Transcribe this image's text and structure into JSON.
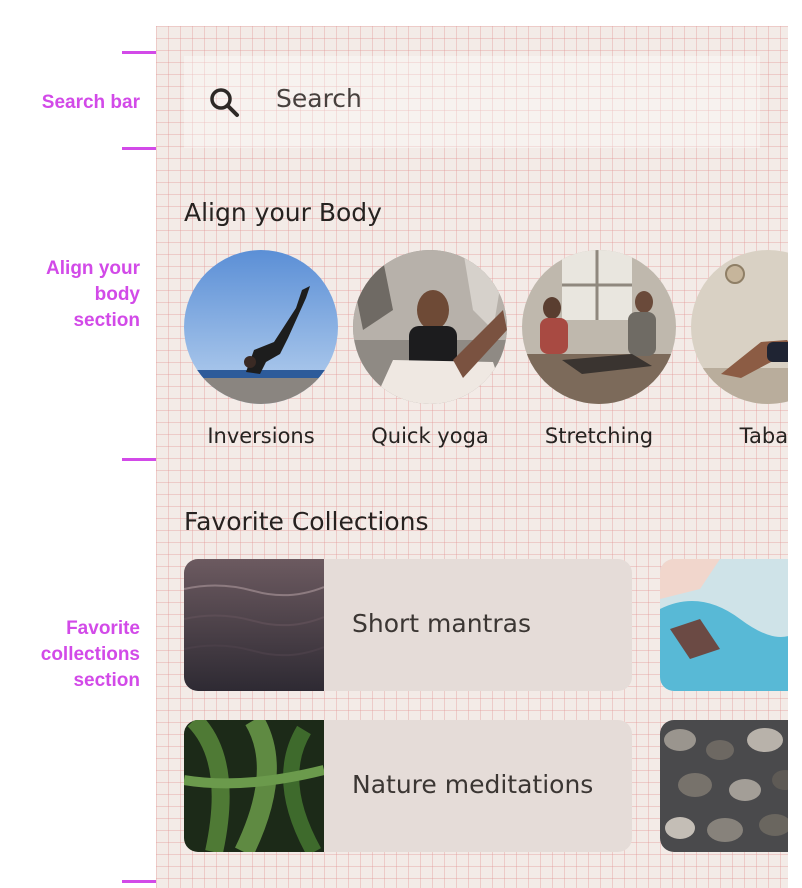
{
  "annotations": {
    "search_bar": "Search bar",
    "align_body": [
      "Align your",
      "body",
      "section"
    ],
    "favorite_collections": [
      "Favorite",
      "collections",
      "section"
    ]
  },
  "search": {
    "placeholder": "Search",
    "icon": "search-icon"
  },
  "align_body": {
    "title": "Align your Body",
    "items": [
      {
        "label": "Inversions"
      },
      {
        "label": "Quick yoga"
      },
      {
        "label": "Stretching"
      },
      {
        "label": "Tabat"
      }
    ]
  },
  "favorites": {
    "title": "Favorite Collections",
    "cards": [
      {
        "label": "Short mantras"
      },
      {
        "label": ""
      },
      {
        "label": "Nature meditations"
      },
      {
        "label": ""
      }
    ]
  },
  "colors": {
    "annotation": "#d24ae8",
    "background": "#f3ebe7",
    "card": "#e5dcd8",
    "text": "#262220"
  }
}
